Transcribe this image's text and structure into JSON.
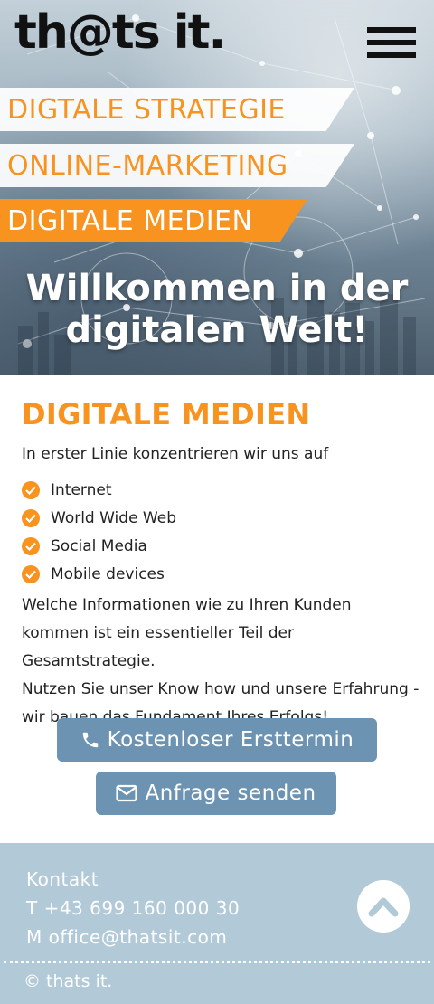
{
  "header": {
    "logo_text": "th@ts it.",
    "menu_icon": "hamburger-menu-icon"
  },
  "hero": {
    "bands": [
      "DIGTALE STRATEGIE",
      "ONLINE-MARKETING",
      "DIGITALE MEDIEN"
    ],
    "welcome_line1": "Willkommen in der",
    "welcome_line2": "digitalen Welt!"
  },
  "main": {
    "title": "DIGITALE MEDIEN",
    "intro": "In erster Linie konzentrieren wir uns auf",
    "items": [
      "Internet",
      "World Wide Web",
      "Social Media",
      "Mobile devices"
    ],
    "paragraph1": "Welche Informationen wie zu Ihren Kunden kommen ist ein essentieller Teil der Gesamtstrategie.",
    "paragraph2": "Nutzen Sie unser Know how und unsere Erfahrung - wir bauen das Fundament Ihres Erfolgs!"
  },
  "buttons": {
    "call_label": "Kostenloser Ersttermin",
    "call_icon": "phone-icon",
    "request_label": "Anfrage senden",
    "request_icon": "envelope-icon"
  },
  "footer": {
    "title": "Kontakt",
    "phone": "T +43 699 160 000 30",
    "email": "M office@thatsit.com",
    "copyright": "© thats it.",
    "top_icon": "chevron-up-icon"
  },
  "colors": {
    "accent": "#f7931e",
    "button": "#6c93b1",
    "footer": "#b2cad8"
  }
}
